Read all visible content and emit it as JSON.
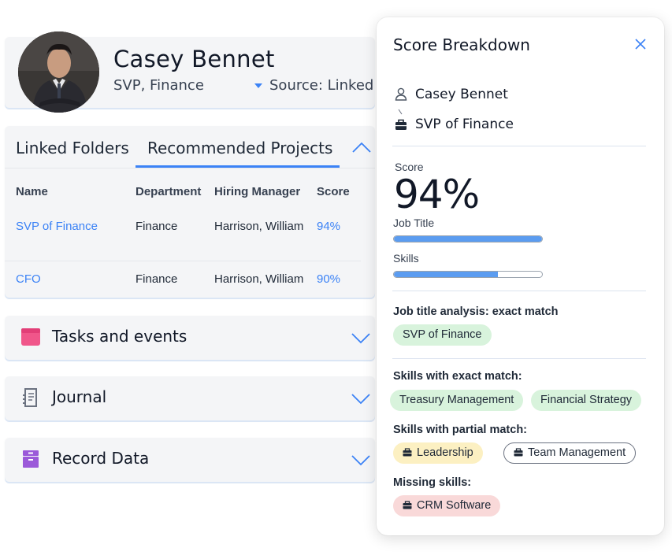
{
  "profile": {
    "name": "Casey Bennet",
    "role": "SVP, Finance",
    "source": "Source: LinkedIn"
  },
  "projects": {
    "tabs": [
      "Linked Folders",
      "Recommended Projects"
    ],
    "columns": [
      "Name",
      "Department",
      "Hiring Manager",
      "Score"
    ],
    "rows": [
      {
        "name": "SVP of Finance",
        "department": "Finance",
        "manager": "Harrison, William",
        "score": "94%"
      },
      {
        "name": "CFO",
        "department": "Finance",
        "manager": "Harrison, William",
        "score": "90%"
      }
    ]
  },
  "sections": [
    {
      "title": "Tasks and events",
      "icon": "calendar-icon"
    },
    {
      "title": "Journal",
      "icon": "document-icon"
    },
    {
      "title": "Record Data",
      "icon": "archive-icon"
    }
  ],
  "panel": {
    "title": "Score Breakdown",
    "candidate": "Casey Bennet",
    "position": "SVP of Finance",
    "score_label": "Score",
    "score_value": "94%",
    "job_title_label": "Job Title",
    "job_title_fill": 1.0,
    "skills_label": "Skills",
    "skills_fill": 0.7,
    "job_title_analysis": "Job title analysis: exact match",
    "job_title_chip": "SVP of Finance",
    "exact_label": "Skills with exact match:",
    "exact_skills": [
      "Treasury Management",
      "Financial Strategy"
    ],
    "partial_label": "Skills with partial match:",
    "partial_skills": [
      "Leadership",
      "Team Management"
    ],
    "missing_label": "Missing skills:",
    "missing_skills": [
      "CRM Software"
    ]
  },
  "colors": {
    "accent": "#3b82f6",
    "tasks_icon": "#f0568a",
    "journal_icon": "#6b7280",
    "record_icon": "#9b59d9"
  }
}
